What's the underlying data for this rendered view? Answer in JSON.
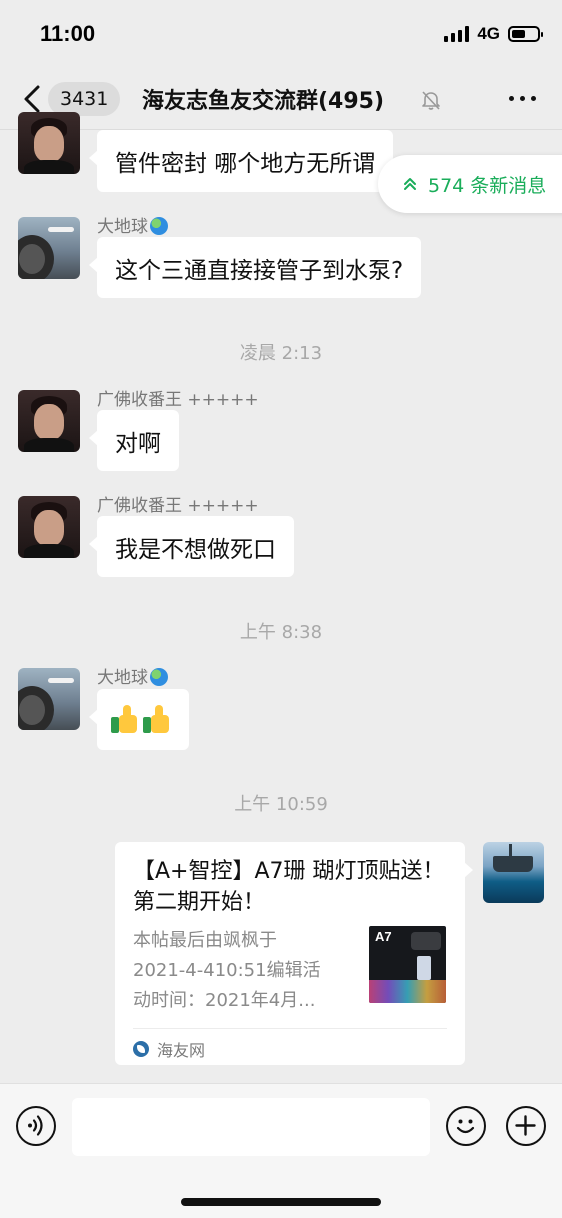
{
  "status_bar": {
    "time": "11:00",
    "network": "4G"
  },
  "nav": {
    "unread_count": "3431",
    "title": "海友志鱼友交流群(495)"
  },
  "new_messages": {
    "label": "574 条新消息"
  },
  "messages": [
    {
      "text": "管件密封 哪个地方无所谓"
    },
    {
      "sender": "大地球",
      "text": "这个三通直接接管子到水泵?"
    },
    {
      "timestamp": "凌晨 2:13"
    },
    {
      "sender": "广佛收番王 +++++",
      "text": "对啊"
    },
    {
      "sender": "广佛收番王 +++++",
      "text": "我是不想做死口"
    },
    {
      "timestamp": "上午 8:38"
    },
    {
      "sender": "大地球",
      "emoji": [
        "thumbs-up",
        "thumbs-up"
      ]
    },
    {
      "timestamp": "上午 10:59"
    }
  ],
  "link_card": {
    "title": "【A+智控】A7珊 瑚灯顶贴送！第二期开始！",
    "desc_lines": [
      "本帖最后由飒枫于",
      "2021-4-410:51编辑活",
      "动时间：2021年4月..."
    ],
    "thumb_text": "A7",
    "source": "海友网"
  },
  "input": {
    "placeholder": ""
  },
  "colors": {
    "accent_green": "#1aad5a",
    "background": "#ededed",
    "bubble": "#ffffff"
  }
}
